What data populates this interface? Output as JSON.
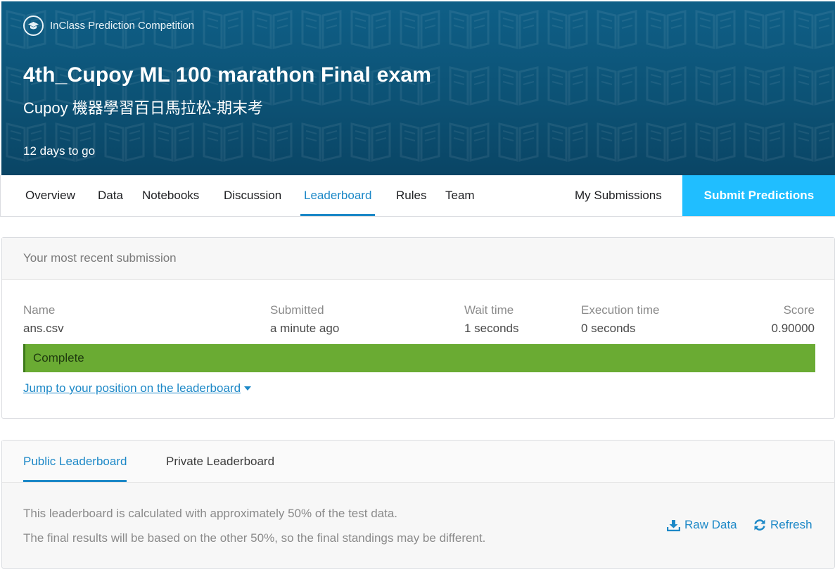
{
  "banner": {
    "badge_text": "InClass Prediction Competition",
    "title": "4th_Cupoy ML 100 marathon Final exam",
    "subtitle": "Cupoy 機器學習百日馬拉松-期末考",
    "deadline": "12 days to go"
  },
  "tabs": [
    {
      "label": "Overview"
    },
    {
      "label": "Data"
    },
    {
      "label": "Notebooks"
    },
    {
      "label": "Discussion"
    },
    {
      "label": "Leaderboard",
      "active": true
    },
    {
      "label": "Rules"
    },
    {
      "label": "Team"
    }
  ],
  "my_submissions_label": "My Submissions",
  "submit_label": "Submit Predictions",
  "recent": {
    "header": "Your most recent submission",
    "columns": {
      "name": {
        "label": "Name",
        "value": "ans.csv"
      },
      "submitted": {
        "label": "Submitted",
        "value": "a minute ago"
      },
      "wait": {
        "label": "Wait time",
        "value": "1 seconds"
      },
      "execution": {
        "label": "Execution time",
        "value": "0 seconds"
      },
      "score": {
        "label": "Score",
        "value": "0.90000"
      }
    },
    "status": "Complete",
    "jump_link": "Jump to your position on the leaderboard"
  },
  "leaderboard": {
    "tabs": [
      {
        "label": "Public Leaderboard",
        "active": true
      },
      {
        "label": "Private Leaderboard"
      }
    ],
    "note_line1": "This leaderboard is calculated with approximately 50% of the test data.",
    "note_line2": "The final results will be based on the other 50%, so the final standings may be different.",
    "raw_data_label": "Raw Data",
    "refresh_label": "Refresh"
  },
  "colors": {
    "accent": "#1c88c7",
    "submit_button": "#20beff",
    "banner": "#0c5275",
    "complete": "#6aab33"
  },
  "icons": [
    "graduation-cap-icon",
    "book-pattern",
    "caret-down-icon",
    "download-icon",
    "refresh-icon"
  ]
}
